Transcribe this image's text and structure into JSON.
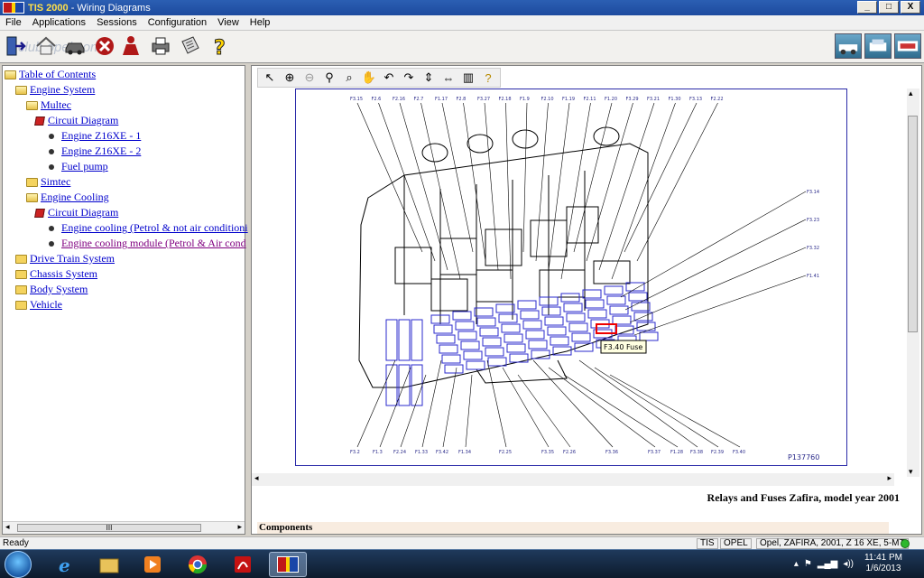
{
  "window": {
    "app_name": "TIS 2000",
    "title_suffix": " - Wiring Diagrams",
    "min": "_",
    "max": "□",
    "close": "X"
  },
  "menu": [
    "File",
    "Applications",
    "Sessions",
    "Configuration",
    "View",
    "Help"
  ],
  "toolbar": {
    "watermark": "club opel.com"
  },
  "tree": {
    "toc": "Table of Contents",
    "engine_system": "Engine System",
    "multec": "Multec",
    "circuit_diagram_1": "Circuit Diagram",
    "engine_1": "Engine Z16XE - 1",
    "engine_2": "Engine Z16XE - 2",
    "fuel_pump": "Fuel pump",
    "simtec": "Simtec",
    "engine_cooling": "Engine Cooling",
    "circuit_diagram_2": "Circuit Diagram",
    "cooling_petrol_no_air": "Engine cooling (Petrol & not air conditioni",
    "cooling_module": "Engine cooling module (Petrol & Air cond",
    "drive_train": "Drive Train System",
    "chassis": "Chassis System",
    "body": "Body System",
    "vehicle": "Vehicle",
    "scroll_thumb": "III"
  },
  "diagram": {
    "top_labels": [
      "F3.15",
      "F2.6",
      "F2.16",
      "F2.7",
      "F1.17",
      "F2.8",
      "F3.27",
      "F2.18",
      "F1.9",
      "F2.10",
      "F1.19",
      "F2.11",
      "F1.20",
      "F3.29",
      "F3.21",
      "F1.30",
      "F3.13",
      "F2.22"
    ],
    "right_labels": [
      "F3.14",
      "F3.23",
      "F3.32",
      "F1.41"
    ],
    "bottom_labels": [
      "F3.2",
      "F1.3",
      "F2.24",
      "F1.33",
      "F3.42",
      "F1.34",
      "F2.25",
      "F3.35",
      "F2.26",
      "F3.36",
      "F3.37",
      "F1.28",
      "F3.38",
      "F2.39",
      "F3.40"
    ],
    "tooltip": "F3.40 Fuse",
    "ref": "P137760"
  },
  "caption": "Relays and Fuses Zafira, model year 2001",
  "components_heading": "Components",
  "status": {
    "ready": "Ready",
    "tis": "TIS",
    "brand": "OPEL",
    "vehicle": "Opel, ZAFIRA, 2001, Z 16 XE, 5-MT"
  },
  "taskbar": {
    "time": "11:41 PM",
    "date": "1/6/2013"
  }
}
